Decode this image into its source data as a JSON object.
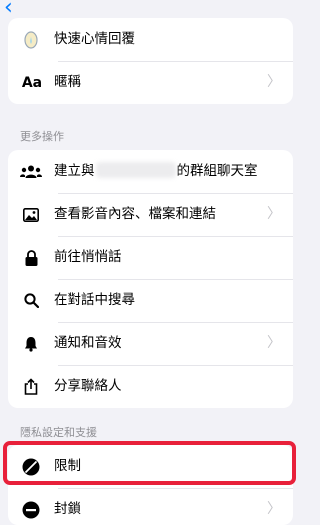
{
  "nav": {
    "back_glyph": "‹"
  },
  "top_items": [
    {
      "icon": "heart-reaction-icon",
      "label": "快速心情回覆",
      "chevron": false
    },
    {
      "icon": "nickname-aa-icon",
      "icon_text": "Aa",
      "label": "暱稱",
      "chevron": true
    }
  ],
  "more_actions": {
    "heading": "更多操作",
    "items": [
      {
        "icon": "people-icon",
        "label_prefix": "建立與",
        "label_suffix": "的群組聊天室",
        "chevron": false
      },
      {
        "icon": "image-icon",
        "label": "查看影音內容、檔案和連結",
        "chevron": true
      },
      {
        "icon": "lock-icon",
        "label": "前往悄悄話",
        "chevron": false
      },
      {
        "icon": "search-icon",
        "label": "在對話中搜尋",
        "chevron": false
      },
      {
        "icon": "bell-icon",
        "label": "通知和音效",
        "chevron": true
      },
      {
        "icon": "share-icon",
        "label": "分享聯絡人",
        "chevron": false
      }
    ]
  },
  "privacy": {
    "heading": "隱私設定和支援",
    "items": [
      {
        "icon": "restrict-icon",
        "label": "限制",
        "chevron": false,
        "highlighted": true
      },
      {
        "icon": "block-icon",
        "label": "封鎖",
        "chevron": true
      }
    ]
  },
  "colors": {
    "accent": "#007aff",
    "highlight": "#e8203a",
    "background": "#f2f2f7"
  }
}
